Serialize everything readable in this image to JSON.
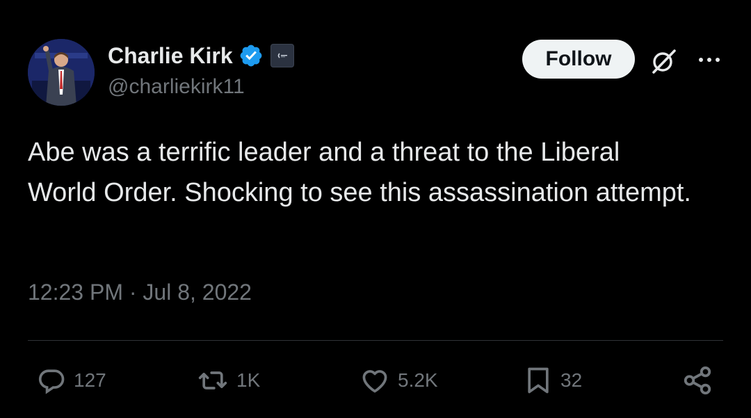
{
  "author": {
    "display_name": "Charlie Kirk",
    "handle": "@charliekirk11"
  },
  "header": {
    "follow_label": "Follow"
  },
  "tweet": {
    "text": "Abe was a terrific leader and a threat to the Liberal World Order. Shocking to see this assassination attempt.",
    "timestamp": "12:23 PM · Jul 8, 2022"
  },
  "actions": {
    "reply_count": "127",
    "retweet_count": "1K",
    "like_count": "5.2K",
    "bookmark_count": "32"
  },
  "icons": {
    "verified": "verified-badge-icon",
    "affiliate": "affiliate-badge-icon",
    "grok": "grok-icon",
    "more": "more-dots-icon",
    "reply": "reply-icon",
    "retweet": "retweet-icon",
    "like": "heart-icon",
    "bookmark": "bookmark-icon",
    "share": "share-icon"
  },
  "colors": {
    "background": "#000000",
    "text_primary": "#e7e9ea",
    "text_secondary": "#71767b",
    "verified_blue": "#1d9bf0",
    "follow_button_bg": "#eff3f4",
    "divider": "#2f3336"
  }
}
